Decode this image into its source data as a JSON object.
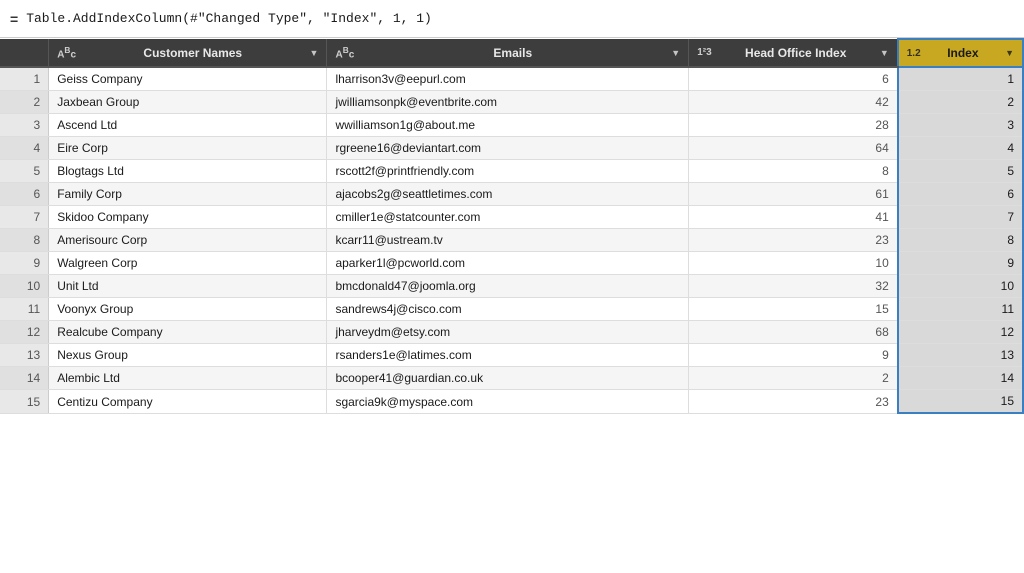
{
  "formula_bar": {
    "equals": "=",
    "text": "Table.AddIndexColumn(#\"Changed Type\", \"Index\", 1, 1)"
  },
  "columns": [
    {
      "id": "row-num",
      "label": "",
      "type": "",
      "class": "row-num-header"
    },
    {
      "id": "customer-names",
      "label": "Customer Names",
      "type": "ABc",
      "class": ""
    },
    {
      "id": "emails",
      "label": "Emails",
      "type": "ABc",
      "class": ""
    },
    {
      "id": "head-office-index",
      "label": "Head Office Index",
      "type": "1²3",
      "class": ""
    },
    {
      "id": "index",
      "label": "Index",
      "type": "1.2",
      "class": "index-col-header"
    }
  ],
  "rows": [
    {
      "num": 1,
      "customer": "Geiss Company",
      "email": "lharrison3v@eepurl.com",
      "headoffice": 6,
      "index": 1
    },
    {
      "num": 2,
      "customer": "Jaxbean Group",
      "email": "jwilliamsonpk@eventbrite.com",
      "headoffice": 42,
      "index": 2
    },
    {
      "num": 3,
      "customer": "Ascend Ltd",
      "email": "wwilliamson1g@about.me",
      "headoffice": 28,
      "index": 3
    },
    {
      "num": 4,
      "customer": "Eire Corp",
      "email": "rgreene16@deviantart.com",
      "headoffice": 64,
      "index": 4
    },
    {
      "num": 5,
      "customer": "Blogtags Ltd",
      "email": "rscott2f@printfriendly.com",
      "headoffice": 8,
      "index": 5
    },
    {
      "num": 6,
      "customer": "Family Corp",
      "email": "ajacobs2g@seattletimes.com",
      "headoffice": 61,
      "index": 6
    },
    {
      "num": 7,
      "customer": "Skidoo Company",
      "email": "cmiller1e@statcounter.com",
      "headoffice": 41,
      "index": 7
    },
    {
      "num": 8,
      "customer": "Amerisourc Corp",
      "email": "kcarr11@ustream.tv",
      "headoffice": 23,
      "index": 8
    },
    {
      "num": 9,
      "customer": "Walgreen Corp",
      "email": "aparker1l@pcworld.com",
      "headoffice": 10,
      "index": 9
    },
    {
      "num": 10,
      "customer": "Unit Ltd",
      "email": "bmcdonald47@joomla.org",
      "headoffice": 32,
      "index": 10
    },
    {
      "num": 11,
      "customer": "Voonyx Group",
      "email": "sandrews4j@cisco.com",
      "headoffice": 15,
      "index": 11
    },
    {
      "num": 12,
      "customer": "Realcube Company",
      "email": "jharveydm@etsy.com",
      "headoffice": 68,
      "index": 12
    },
    {
      "num": 13,
      "customer": "Nexus Group",
      "email": "rsanders1e@latimes.com",
      "headoffice": 9,
      "index": 13
    },
    {
      "num": 14,
      "customer": "Alembic Ltd",
      "email": "bcooper41@guardian.co.uk",
      "headoffice": 2,
      "index": 14
    },
    {
      "num": 15,
      "customer": "Centizu Company",
      "email": "sgarcia9k@myspace.com",
      "headoffice": 23,
      "index": 15
    }
  ]
}
